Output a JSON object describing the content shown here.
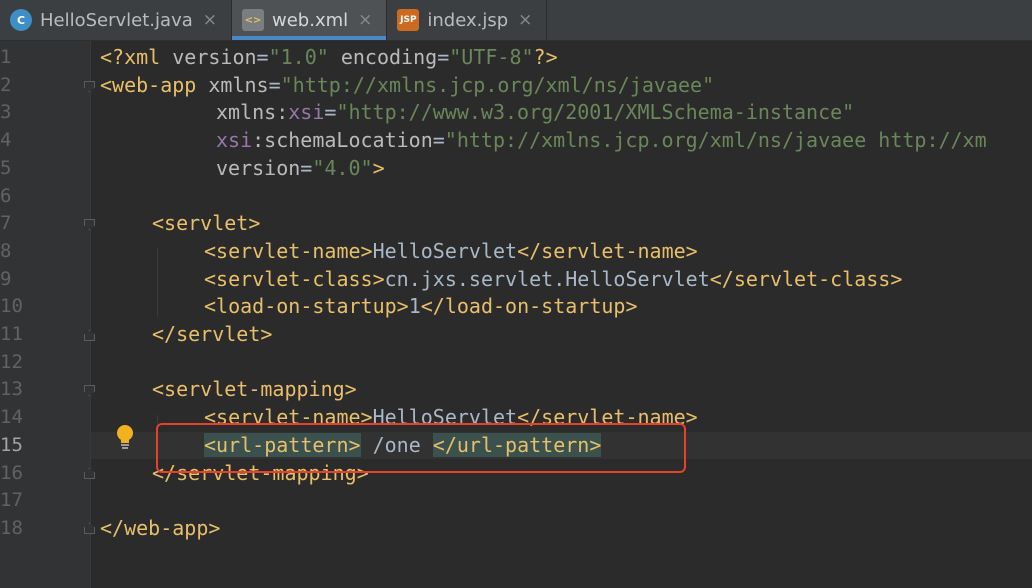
{
  "tabs": [
    {
      "label": "HelloServlet.java",
      "icon": "java-class-icon",
      "icon_text": "C",
      "active": false
    },
    {
      "label": "web.xml",
      "icon": "xml-file-icon",
      "icon_text": "<>",
      "active": true
    },
    {
      "label": "index.jsp",
      "icon": "jsp-file-icon",
      "icon_text": "JSP",
      "active": false
    }
  ],
  "close_glyph": "×",
  "line_numbers": [
    "1",
    "2",
    "3",
    "4",
    "5",
    "6",
    "7",
    "8",
    "9",
    "10",
    "11",
    "12",
    "13",
    "14",
    "15",
    "16",
    "17",
    "18"
  ],
  "current_line": 15,
  "code": {
    "l1": {
      "a": "<?xml ",
      "b": "version",
      "c": "=",
      "d": "\"1.0\"",
      "e": " encoding",
      "f": "=",
      "g": "\"UTF-8\"",
      "h": "?>"
    },
    "l2": {
      "a": "<web-app ",
      "b": "xmlns",
      "c": "=",
      "d": "\"http://xmlns.jcp.org/xml/ns/javaee\""
    },
    "l3": {
      "a": "xmlns",
      "b": ":",
      "c": "xsi",
      "d": "=",
      "e": "\"http://www.w3.org/2001/XMLSchema-instance\""
    },
    "l4": {
      "a": "xsi",
      "b": ":schemaLocation",
      "c": "=",
      "d": "\"http://xmlns.jcp.org/xml/ns/javaee http://xm"
    },
    "l5": {
      "a": "version",
      "b": "=",
      "c": "\"4.0\"",
      "d": ">"
    },
    "l7": {
      "a": "<servlet>"
    },
    "l8": {
      "a": "<servlet-name>",
      "b": "HelloServlet",
      "c": "</servlet-name>"
    },
    "l9": {
      "a": "<servlet-class>",
      "b": "cn.jxs.servlet.HelloServlet",
      "c": "</servlet-class>"
    },
    "l10": {
      "a": "<load-on-startup>",
      "b": "1",
      "c": "</load-on-startup>"
    },
    "l11": {
      "a": "</servlet>"
    },
    "l13": {
      "a": "<servlet-mapping>"
    },
    "l14": {
      "a": "<servlet-name>",
      "b": "HelloServlet",
      "c": "</servlet-name>"
    },
    "l15": {
      "a": "<url-pattern>",
      "b": " /one ",
      "c": "</url-pattern>"
    },
    "l16": {
      "a": "</servlet-mapping>"
    },
    "l18": {
      "a": "</web-app>"
    }
  },
  "colors": {
    "background": "#2b2b2b",
    "tag": "#e8bf6a",
    "namespace": "#9876aa",
    "value": "#6a8759",
    "highlight_box": "#e8412a"
  }
}
